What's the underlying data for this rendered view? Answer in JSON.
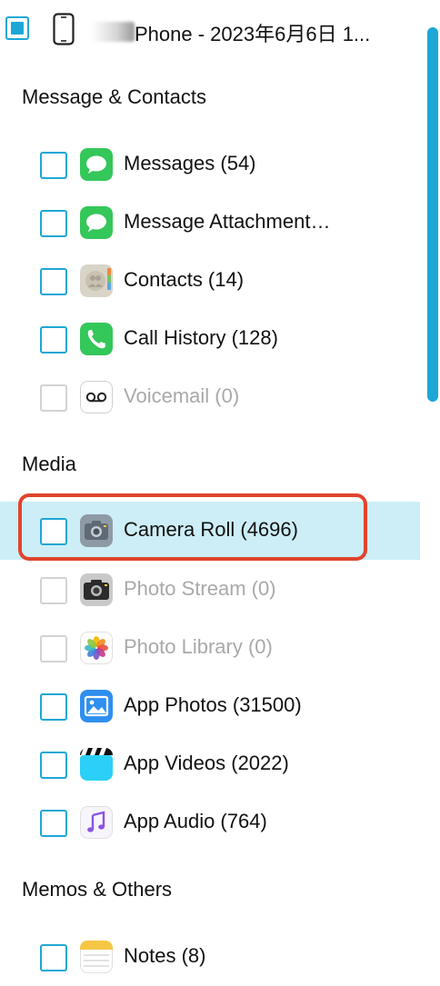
{
  "device": {
    "label": "Phone  - 2023年6月6日 1...",
    "checkbox_state": "partial",
    "icon": "iphone-icon"
  },
  "sections": [
    {
      "header": "Message & Contacts"
    },
    {
      "header": "Media"
    },
    {
      "header": "Memos & Others"
    }
  ],
  "items": [
    {
      "label": "Messages (54)",
      "icon": "messages-icon",
      "enabled": true,
      "selected": false
    },
    {
      "label": "Message Attachment…",
      "icon": "message-attachments-icon",
      "enabled": true,
      "selected": false
    },
    {
      "label": "Contacts (14)",
      "icon": "contacts-icon",
      "enabled": true,
      "selected": false
    },
    {
      "label": "Call History (128)",
      "icon": "phone-icon",
      "enabled": true,
      "selected": false
    },
    {
      "label": "Voicemail (0)",
      "icon": "voicemail-icon",
      "enabled": false,
      "selected": false
    },
    {
      "label": "Camera Roll (4696)",
      "icon": "camera-icon",
      "enabled": true,
      "selected": true
    },
    {
      "label": "Photo Stream (0)",
      "icon": "photo-stream-icon",
      "enabled": false,
      "selected": false
    },
    {
      "label": "Photo Library (0)",
      "icon": "photos-icon",
      "enabled": false,
      "selected": false
    },
    {
      "label": "App Photos (31500)",
      "icon": "image-icon",
      "enabled": true,
      "selected": false
    },
    {
      "label": "App Videos (2022)",
      "icon": "clapper-icon",
      "enabled": true,
      "selected": false
    },
    {
      "label": "App Audio (764)",
      "icon": "music-note-icon",
      "enabled": true,
      "selected": false
    },
    {
      "label": "Notes (8)",
      "icon": "notes-icon",
      "enabled": true,
      "selected": false
    }
  ],
  "colors": {
    "accent": "#1ea7d6",
    "selected_row": "#cdeef6",
    "highlight_border": "#e0442f",
    "disabled_text": "#a9a9a9"
  }
}
